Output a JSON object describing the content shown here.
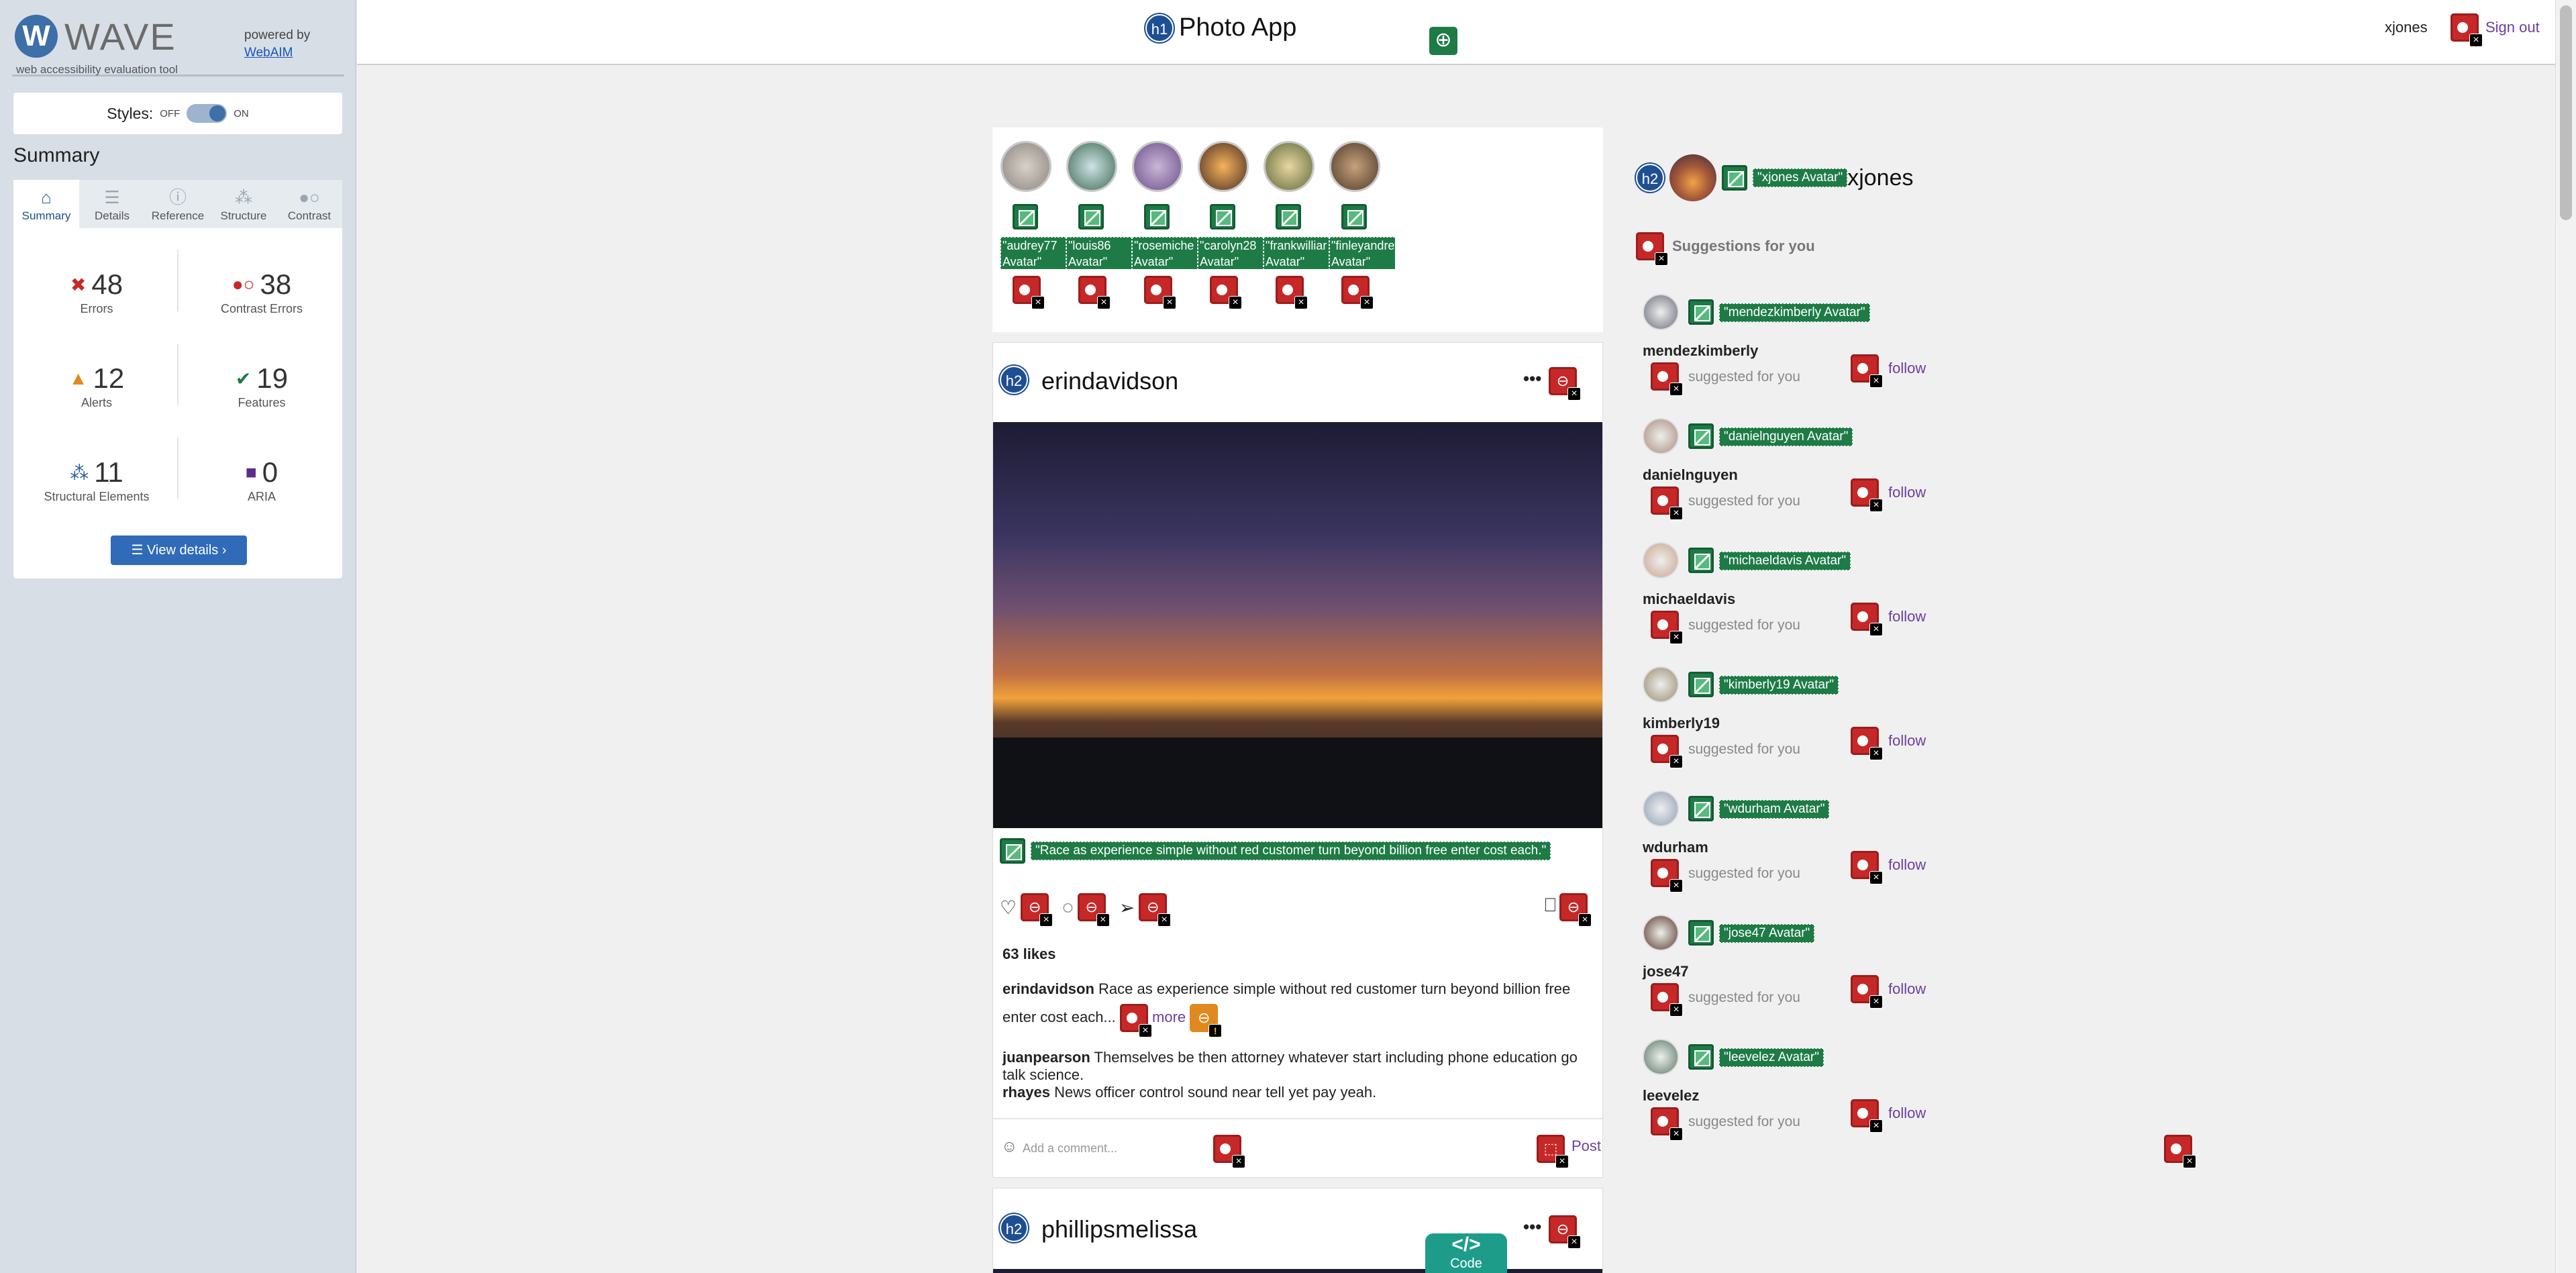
{
  "wave": {
    "name": "WAVE",
    "tagline": "web accessibility evaluation tool",
    "powered_by": "powered by",
    "webaim": "WebAIM",
    "styles_label": "Styles:",
    "styles_off": "OFF",
    "styles_on": "ON",
    "summary_title": "Summary",
    "tabs": [
      "Summary",
      "Details",
      "Reference",
      "Structure",
      "Contrast"
    ],
    "stats": {
      "errors": {
        "value": "48",
        "label": "Errors"
      },
      "contrast": {
        "value": "38",
        "label": "Contrast Errors"
      },
      "alerts": {
        "value": "12",
        "label": "Alerts"
      },
      "features": {
        "value": "19",
        "label": "Features"
      },
      "structural": {
        "value": "11",
        "label": "Structural Elements"
      },
      "aria": {
        "value": "0",
        "label": "ARIA"
      }
    },
    "view_details": "View details ›",
    "colors": {
      "error": "#c62828",
      "feature": "#1e7b46",
      "alert": "#e0891e",
      "heading": "#1f4f93"
    }
  },
  "app": {
    "h1_badge": "h1",
    "title": "Photo App",
    "user": "xjones",
    "sign_out": "Sign out",
    "stories": [
      {
        "alt": "\"audrey77 Avatar\""
      },
      {
        "alt": "\"louis86 Avatar\""
      },
      {
        "alt": "\"rosemiche Avatar\""
      },
      {
        "alt": "\"carolyn28 Avatar\""
      },
      {
        "alt": "\"frankwilliar Avatar\""
      },
      {
        "alt": "\"finleyandrew Avatar\""
      }
    ],
    "post1": {
      "h2": "h2",
      "username": "erindavidson",
      "more_icon": "•••",
      "image_alt": "\"Race as experience simple without red customer turn beyond billion free enter cost each.\"",
      "likes": "63 likes",
      "caption_user": "erindavidson",
      "caption_text": "Race as experience simple without red customer turn beyond billion free enter cost each...",
      "more_link": "more",
      "comments": [
        {
          "user": "juanpearson",
          "text": "Themselves be then attorney whatever start including phone education go talk science."
        },
        {
          "user": "rhayes",
          "text": "News officer control sound near tell yet pay yeah."
        }
      ],
      "comment_placeholder": "Add a comment...",
      "post_btn": "Post"
    },
    "post2": {
      "h2": "h2",
      "username": "phillipsmelissa",
      "more_icon": "•••"
    },
    "code_btn": "Code",
    "code_icon": "</>",
    "sidebar": {
      "h2": "h2",
      "avatar_alt": "\"xjones Avatar\"",
      "username": "xjones",
      "suggestions_title": "Suggestions for you",
      "items": [
        {
          "alt": "\"mendezkimberly Avatar\"",
          "username": "mendezkimberly",
          "sub": "suggested for you",
          "follow": "follow"
        },
        {
          "alt": "\"danielnguyen Avatar\"",
          "username": "danielnguyen",
          "sub": "suggested for you",
          "follow": "follow"
        },
        {
          "alt": "\"michaeldavis Avatar\"",
          "username": "michaeldavis",
          "sub": "suggested for you",
          "follow": "follow"
        },
        {
          "alt": "\"kimberly19 Avatar\"",
          "username": "kimberly19",
          "sub": "suggested for you",
          "follow": "follow"
        },
        {
          "alt": "\"wdurham Avatar\"",
          "username": "wdurham",
          "sub": "suggested for you",
          "follow": "follow"
        },
        {
          "alt": "\"jose47 Avatar\"",
          "username": "jose47",
          "sub": "suggested for you",
          "follow": "follow"
        },
        {
          "alt": "\"leevelez Avatar\"",
          "username": "leevelez",
          "sub": "suggested for you",
          "follow": "follow"
        }
      ]
    }
  }
}
